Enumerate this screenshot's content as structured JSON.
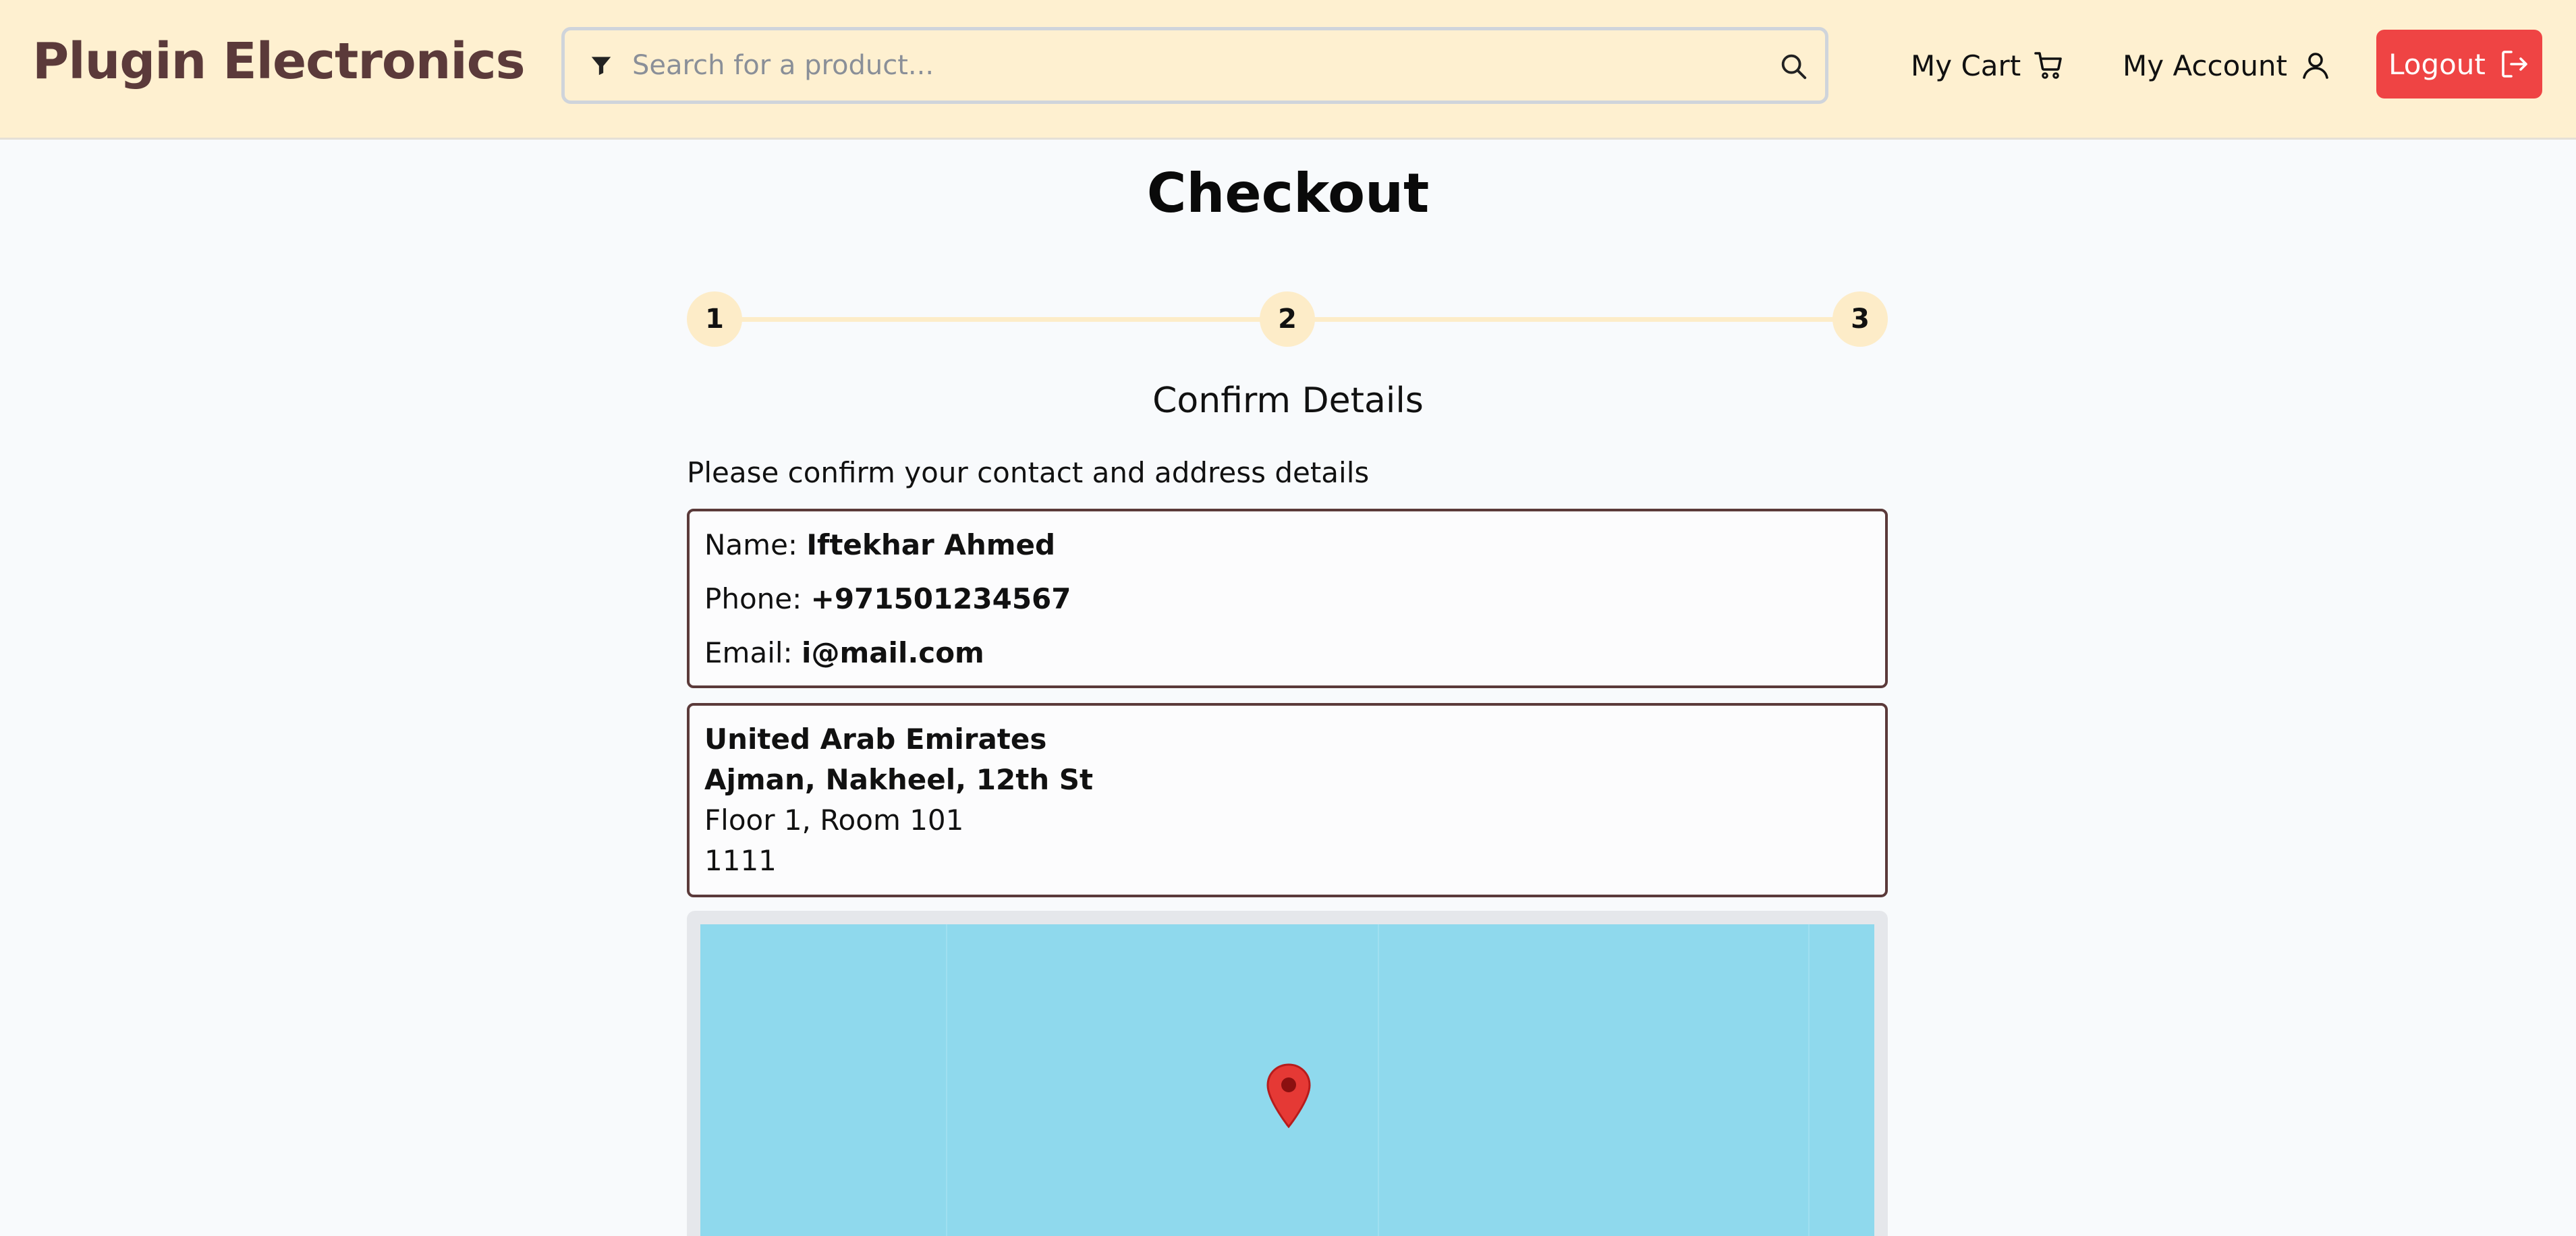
{
  "header": {
    "logo": "Plugin Electronics",
    "search": {
      "placeholder": "Search for a product...",
      "value": ""
    },
    "cart_label": "My Cart",
    "account_label": "My Account",
    "logout_label": "Logout"
  },
  "page": {
    "title": "Checkout"
  },
  "stepper": {
    "steps": [
      "1",
      "2",
      "3"
    ]
  },
  "section": {
    "title": "Confirm Details",
    "instruction": "Please confirm your contact and address details"
  },
  "contact": {
    "name_label": "Name:",
    "name": "Iftekhar Ahmed",
    "phone_label": "Phone:",
    "phone": "+971501234567",
    "email_label": "Email:",
    "email": "i@mail.com"
  },
  "address": {
    "country": "United Arab Emirates",
    "line1": "Ajman, Nakheel, 12th St",
    "line2": "Floor 1, Room 101",
    "postal": "1111"
  },
  "map": {
    "marker": "location-pin-icon"
  },
  "colors": {
    "header_bg": "#fef0d0",
    "brand": "#5b3a3a",
    "logout_bg": "#ef4444",
    "step_bg": "#fdecc8",
    "map_water": "#8fd9ed",
    "pin": "#e53935"
  }
}
